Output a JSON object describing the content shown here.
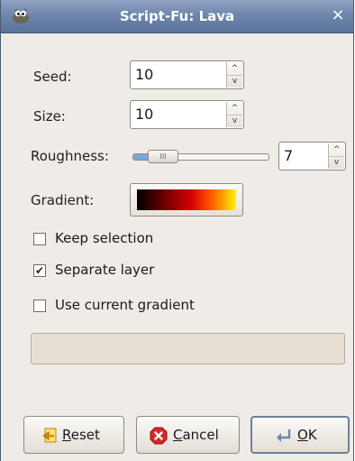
{
  "window": {
    "title": "Script-Fu: Lava",
    "app_icon": "wilber-icon",
    "close_icon": "close-icon",
    "close_glyph": "×"
  },
  "fields": {
    "seed": {
      "label": "Seed:",
      "value": "10"
    },
    "size": {
      "label": "Size:",
      "value": "10"
    },
    "roughness": {
      "label": "Roughness:",
      "value": "7",
      "slider_fraction": 0.14,
      "handle_glyph": "III"
    },
    "gradient": {
      "label": "Gradient:"
    }
  },
  "spin_arrows": {
    "up": "^",
    "down": "v"
  },
  "options": {
    "keep_selection": {
      "label": "Keep selection",
      "checked": false
    },
    "separate_layer": {
      "label": "Separate layer",
      "checked": true
    },
    "use_current_gradient": {
      "label": "Use current gradient",
      "checked": false
    }
  },
  "checkmark": "✔",
  "progress": {
    "fraction": 0
  },
  "buttons": {
    "reset": {
      "label": "Reset",
      "mnemonic": "R",
      "rest": "eset",
      "icon": "reset-icon"
    },
    "cancel": {
      "label": "Cancel",
      "mnemonic": "C",
      "rest": "ancel",
      "icon": "cancel-icon"
    },
    "ok": {
      "label": "OK",
      "mnemonic": "O",
      "rest": "K",
      "icon": "ok-icon"
    }
  },
  "colors": {
    "titlebar": "#6f87ad",
    "dialog_bg": "#efebe7",
    "slider_fill": "#7aa6dc",
    "cancel_red": "#d62a2a"
  }
}
